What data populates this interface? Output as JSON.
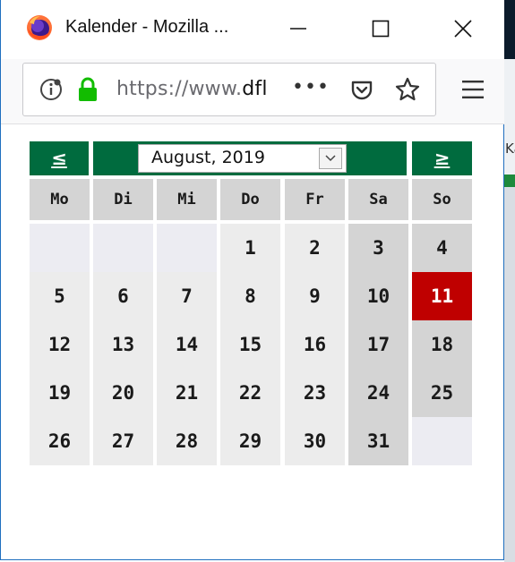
{
  "window": {
    "title": "Kalender - Mozilla ...",
    "url_prefix": "https://www.",
    "url_host": "dfl",
    "page_actions": "•••"
  },
  "calendar": {
    "prev_label": "≤",
    "next_label": "≥",
    "month_select_value": "August, 2019",
    "weekdays": [
      "Mo",
      "Di",
      "Mi",
      "Do",
      "Fr",
      "Sa",
      "So"
    ],
    "weeks": [
      [
        "",
        "",
        "",
        "1",
        "2",
        "3",
        "4"
      ],
      [
        "5",
        "6",
        "7",
        "8",
        "9",
        "10",
        "11"
      ],
      [
        "12",
        "13",
        "14",
        "15",
        "16",
        "17",
        "18"
      ],
      [
        "19",
        "20",
        "21",
        "22",
        "23",
        "24",
        "25"
      ],
      [
        "26",
        "27",
        "28",
        "29",
        "30",
        "31",
        ""
      ]
    ],
    "today": "11",
    "colors": {
      "header_green": "#006b3e",
      "today_red": "#bf0000",
      "weekday_cell": "#ececec",
      "weekend_cell": "#d4d4d4"
    }
  },
  "background_app": {
    "partial_text": "Ka"
  }
}
